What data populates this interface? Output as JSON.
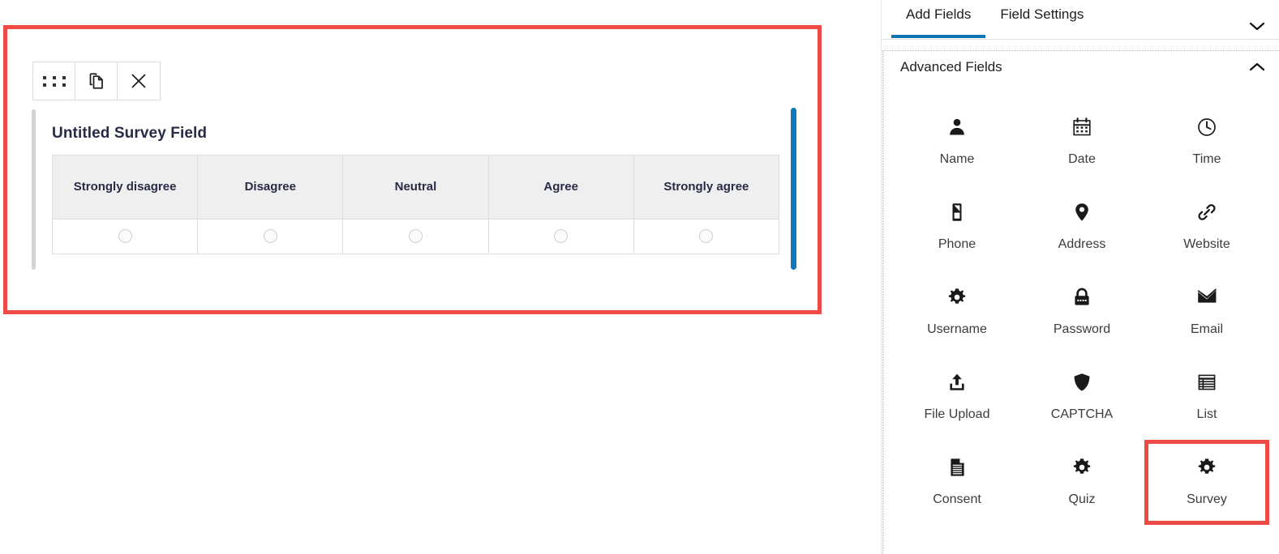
{
  "builder": {
    "toolbar": {
      "drag_label": "drag-handle",
      "duplicate_label": "duplicate-field",
      "delete_label": "delete-field"
    },
    "field": {
      "label": "Untitled Survey Field",
      "type": "survey",
      "columns": [
        "Strongly disagree",
        "Disagree",
        "Neutral",
        "Agree",
        "Strongly agree"
      ],
      "rows": [
        {
          "options": [
            "",
            "",
            "",
            "",
            ""
          ]
        }
      ],
      "selected": true,
      "accent_color": "#1278b8",
      "highlight_color": "#ee4b47"
    }
  },
  "panel": {
    "tabs": [
      {
        "label": "Add Fields",
        "active": true
      },
      {
        "label": "Field Settings",
        "active": false
      }
    ],
    "collapse_icon": "chevron-down-icon",
    "section": {
      "title": "Advanced Fields",
      "expanded": true,
      "toggle_icon": "chevron-up-icon"
    },
    "fields": [
      {
        "label": "Name",
        "icon": "person-icon",
        "highlighted": false
      },
      {
        "label": "Date",
        "icon": "calendar-icon",
        "highlighted": false
      },
      {
        "label": "Time",
        "icon": "clock-icon",
        "highlighted": false
      },
      {
        "label": "Phone",
        "icon": "mobile-phone-icon",
        "highlighted": false
      },
      {
        "label": "Address",
        "icon": "map-pin-icon",
        "highlighted": false
      },
      {
        "label": "Website",
        "icon": "link-chain-icon",
        "highlighted": false
      },
      {
        "label": "Username",
        "icon": "gear-icon",
        "highlighted": false
      },
      {
        "label": "Password",
        "icon": "lock-icon",
        "highlighted": false
      },
      {
        "label": "Email",
        "icon": "envelope-icon",
        "highlighted": false
      },
      {
        "label": "File Upload",
        "icon": "upload-icon",
        "highlighted": false
      },
      {
        "label": "CAPTCHA",
        "icon": "shield-icon",
        "highlighted": false
      },
      {
        "label": "List",
        "icon": "list-table-icon",
        "highlighted": false
      },
      {
        "label": "Consent",
        "icon": "document-icon",
        "highlighted": false
      },
      {
        "label": "Quiz",
        "icon": "gear-icon",
        "highlighted": false
      },
      {
        "label": "Survey",
        "icon": "gear-icon",
        "highlighted": true
      }
    ]
  },
  "colors": {
    "accent_blue": "#0f74b3",
    "highlight_red": "#ee4b47",
    "field_bar_blue": "#1278b8",
    "header_bg": "#efefef",
    "title_text": "#272b46"
  }
}
